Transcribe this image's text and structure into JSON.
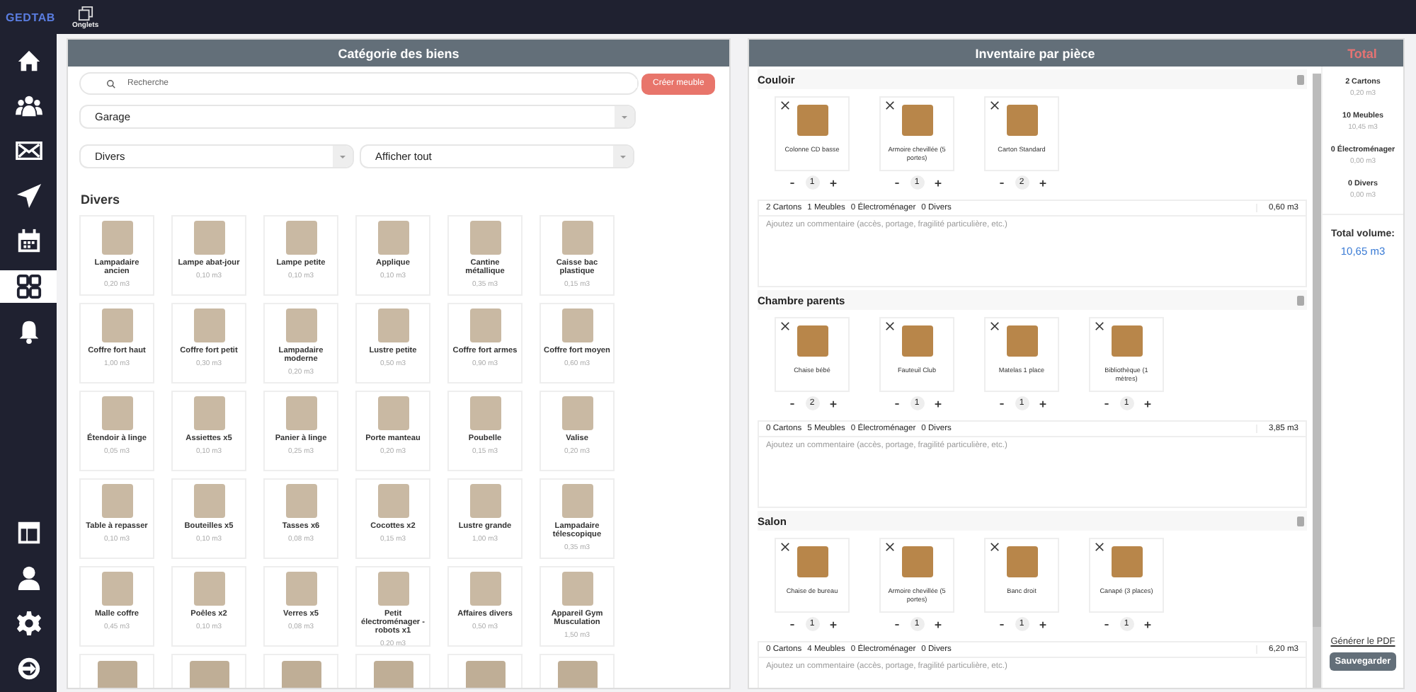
{
  "top_bar": {
    "logo": "GEDTAB",
    "tab_label": "Onglets"
  },
  "sidebar": {
    "items": [
      {
        "kind": "home",
        "selected": false
      },
      {
        "kind": "people",
        "selected": false
      },
      {
        "kind": "mail",
        "selected": false
      },
      {
        "kind": "send",
        "selected": false
      },
      {
        "kind": "calendar",
        "selected": false
      },
      {
        "kind": "grid",
        "selected": true
      },
      {
        "kind": "bell",
        "selected": false
      },
      {
        "kind": "spacer"
      },
      {
        "kind": "layout",
        "selected": false
      },
      {
        "kind": "user",
        "selected": false
      },
      {
        "kind": "gear",
        "selected": false
      },
      {
        "kind": "logout",
        "selected": false
      }
    ]
  },
  "catalog": {
    "title": "Catégorie des biens",
    "search": {
      "placeholder": "Recherche"
    },
    "create_button": "Créer meuble",
    "room_select": "Garage",
    "category_select": "Divers",
    "filter_select": "Afficher tout",
    "section_title": "Divers",
    "items": [
      {
        "name": "Lampadaire ancien",
        "volume": "0,20 m3"
      },
      {
        "name": "Lampe abat-jour",
        "volume": "0,10 m3"
      },
      {
        "name": "Lampe petite",
        "volume": "0,10 m3"
      },
      {
        "name": "Applique",
        "volume": "0,10 m3"
      },
      {
        "name": "Cantine métallique",
        "volume": "0,35 m3"
      },
      {
        "name": "Caisse bac plastique",
        "volume": "0,15 m3"
      },
      {
        "name": "Coffre fort haut",
        "volume": "1,00 m3"
      },
      {
        "name": "Coffre fort petit",
        "volume": "0,30 m3"
      },
      {
        "name": "Lampadaire moderne",
        "volume": "0,20 m3"
      },
      {
        "name": "Lustre petite",
        "volume": "0,50 m3"
      },
      {
        "name": "Coffre fort armes",
        "volume": "0,90 m3"
      },
      {
        "name": "Coffre fort moyen",
        "volume": "0,60 m3"
      },
      {
        "name": "Étendoir à linge",
        "volume": "0,05 m3"
      },
      {
        "name": "Assiettes x5",
        "volume": "0,10 m3"
      },
      {
        "name": "Panier à linge",
        "volume": "0,25 m3"
      },
      {
        "name": "Porte manteau",
        "volume": "0,20 m3"
      },
      {
        "name": "Poubelle",
        "volume": "0,15 m3"
      },
      {
        "name": "Valise",
        "volume": "0,20 m3"
      },
      {
        "name": "Table à repasser",
        "volume": "0,10 m3"
      },
      {
        "name": "Bouteilles x5",
        "volume": "0,10 m3"
      },
      {
        "name": "Tasses x6",
        "volume": "0,08 m3"
      },
      {
        "name": "Cocottes x2",
        "volume": "0,15 m3"
      },
      {
        "name": "Lustre grande",
        "volume": "1,00 m3"
      },
      {
        "name": "Lampadaire télescopique",
        "volume": "0,35 m3"
      },
      {
        "name": "Malle coffre",
        "volume": "0,45 m3"
      },
      {
        "name": "Poêles x2",
        "volume": "0,10 m3"
      },
      {
        "name": "Verres x5",
        "volume": "0,08 m3"
      },
      {
        "name": "Petit électroménager - robots x1",
        "volume": "0,20 m3"
      },
      {
        "name": "Affaires divers",
        "volume": "0,50 m3"
      },
      {
        "name": "Appareil Gym Musculation",
        "volume": "1,50 m3"
      },
      {
        "kind": "image_only"
      },
      {
        "kind": "image_only"
      },
      {
        "kind": "image_only"
      },
      {
        "kind": "image_only"
      },
      {
        "kind": "image_only"
      },
      {
        "kind": "image_only"
      }
    ]
  },
  "inventory": {
    "title": "Inventaire par pièce",
    "rooms": [
      {
        "name": "Couloir",
        "items": [
          {
            "name": "Colonne CD basse",
            "quantity": "1"
          },
          {
            "name": "Armoire chevillée (5 portes)",
            "quantity": "1"
          },
          {
            "name": "Carton Standard",
            "quantity": "2"
          }
        ],
        "summary": [
          "2 Cartons",
          "1 Meubles",
          "0 Électroménager",
          "0 Divers"
        ],
        "volume": "0,60 m3",
        "comment": {
          "placeholder": "Ajoutez un commentaire (accès, portage, fragilité particulière, etc.)"
        }
      },
      {
        "name": "Chambre parents",
        "items": [
          {
            "name": "Chaise bébé",
            "quantity": "2"
          },
          {
            "name": "Fauteuil Club",
            "quantity": "1"
          },
          {
            "name": "Matelas 1 place",
            "quantity": "1"
          },
          {
            "name": "Bibliothèque (1 mètres)",
            "quantity": "1"
          }
        ],
        "summary": [
          "0 Cartons",
          "5 Meubles",
          "0 Électroménager",
          "0 Divers"
        ],
        "volume": "3,85 m3",
        "comment": {
          "placeholder": "Ajoutez un commentaire (accès, portage, fragilité particulière, etc.)"
        }
      },
      {
        "name": "Salon",
        "items": [
          {
            "name": "Chaise de bureau",
            "quantity": "1"
          },
          {
            "name": "Armoire chevillée (5 portes)",
            "quantity": "1"
          },
          {
            "name": "Banc droit",
            "quantity": "1"
          },
          {
            "name": "Canapé (3 places)",
            "quantity": "1"
          }
        ],
        "summary": [
          "0 Cartons",
          "4 Meubles",
          "0 Électroménager",
          "0 Divers"
        ],
        "volume": "6,20 m3",
        "comment": {
          "placeholder": "Ajoutez un commentaire (accès, portage, fragilité particulière, etc.)"
        }
      }
    ]
  },
  "totals": {
    "title": "Total",
    "lines": [
      {
        "label": "2 Cartons",
        "volume": "0,20 m3"
      },
      {
        "label": "10 Meubles",
        "volume": "10,45 m3"
      },
      {
        "label": "0 Électroménager",
        "volume": "0,00 m3"
      },
      {
        "label": "0 Divers",
        "volume": "0,00 m3"
      }
    ],
    "total_label": "Total volume:",
    "total_value": "10,65 m3",
    "pdf_link": "Générer le PDF",
    "save_button": "Sauvegarder"
  }
}
